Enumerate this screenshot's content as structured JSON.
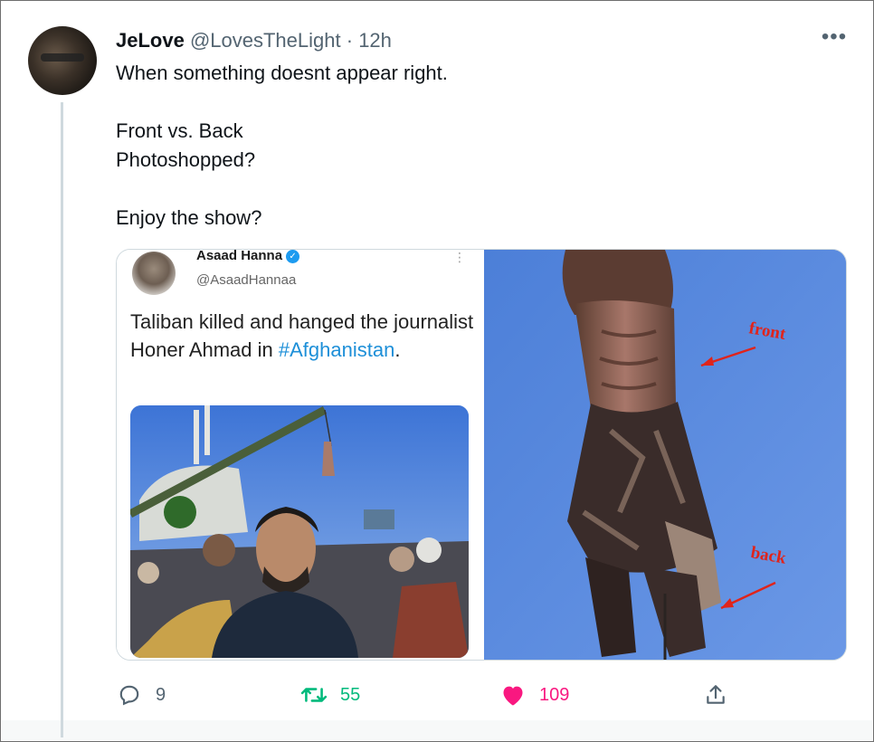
{
  "tweet": {
    "author_name": "JeLove",
    "author_handle": "@LovesTheLight",
    "separator": "·",
    "time": "12h",
    "more_label": "•••",
    "text_lines": [
      "When something doesnt appear right.",
      "",
      "Front vs. Back",
      "Photoshopped?",
      "",
      "Enjoy the show?"
    ]
  },
  "embedded_tweet": {
    "name": "Asaad Hanna",
    "handle": "@AsaadHannaa",
    "text_prefix": "Taliban killed and hanged the journalist Honer Ahmad in ",
    "hashtag": "#Afghanistan",
    "text_suffix": "."
  },
  "zoom_annotations": {
    "front_label": "front",
    "back_label": "back",
    "annotation_color": "#e0241b"
  },
  "actions": {
    "replies": "9",
    "retweets": "55",
    "likes": "109"
  },
  "colors": {
    "reply": "#536471",
    "retweet": "#00ba7c",
    "like": "#f91880",
    "link": "#1d8fd8"
  },
  "icons": {
    "reply": "speech-bubble-icon",
    "retweet": "retweet-arrows-icon",
    "like": "heart-filled-icon",
    "share": "share-upload-icon",
    "more": "ellipsis-icon",
    "verified": "verified-badge-icon"
  }
}
